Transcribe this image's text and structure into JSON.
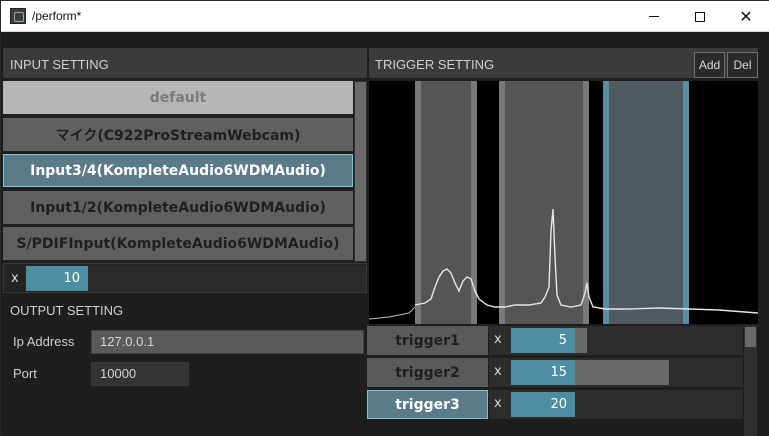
{
  "window": {
    "title": "/perform*",
    "controls": {
      "minimize_icon": "minimize-icon",
      "maximize_icon": "maximize-icon",
      "close_icon": "close-icon"
    }
  },
  "input": {
    "header": "INPUT SETTING",
    "devices": [
      "default",
      "マイク(C922ProStreamWebcam)",
      "Input3/4(KompleteAudio6WDMAudio)",
      "Input1/2(KompleteAudio6WDMAudio)",
      "S/PDIFInput(KompleteAudio6WDMAudio)"
    ],
    "selected_index": 2,
    "multiplier": {
      "label": "x",
      "value": "10"
    }
  },
  "output": {
    "header": "OUTPUT SETTING",
    "ip_label": "Ip Address",
    "ip_value": "127.0.0.1",
    "port_label": "Port",
    "port_value": "10000"
  },
  "trigger": {
    "header": "TRIGGER SETTING",
    "add_label": "Add",
    "del_label": "Del",
    "items": [
      {
        "name": "trigger1",
        "x": "x",
        "value": "5"
      },
      {
        "name": "trigger2",
        "x": "x",
        "value": "15"
      },
      {
        "name": "trigger3",
        "x": "x",
        "value": "20"
      }
    ],
    "selected_index": 2
  },
  "colors": {
    "accent": "#4d8ea5",
    "selected_bg": "#5a7b87",
    "panel": "#3b3b3b",
    "background": "#1e1e1e"
  }
}
